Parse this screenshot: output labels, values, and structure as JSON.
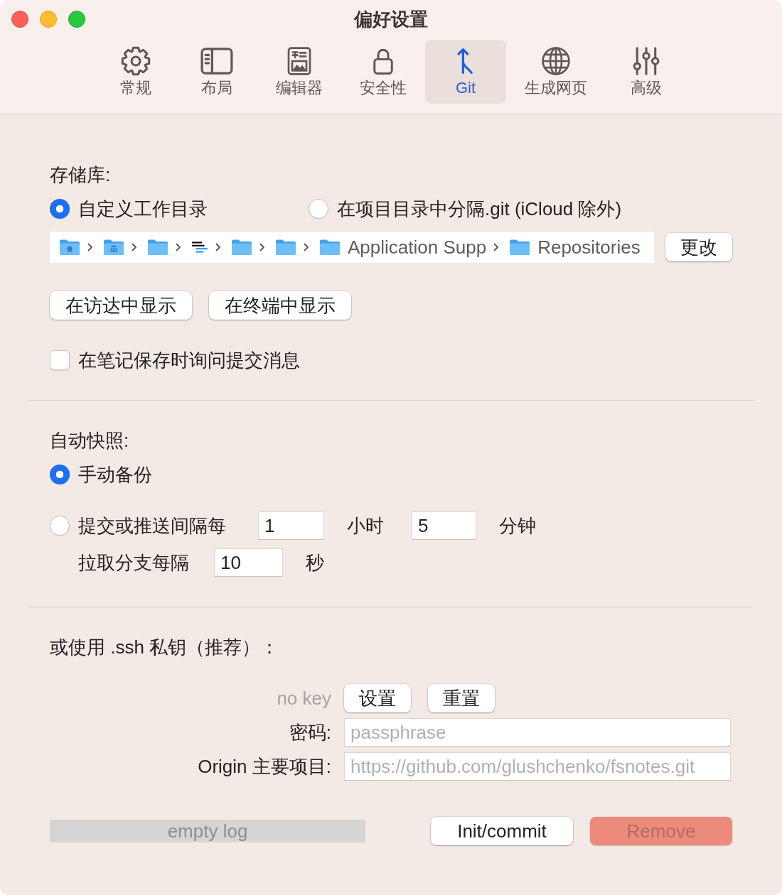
{
  "window": {
    "title": "偏好设置"
  },
  "tabs": [
    {
      "kind": "general",
      "label": "常规",
      "selected": false
    },
    {
      "kind": "layout",
      "label": "布局",
      "selected": false
    },
    {
      "kind": "editor",
      "label": "编辑器",
      "selected": false
    },
    {
      "kind": "security",
      "label": "安全性",
      "selected": false
    },
    {
      "kind": "git",
      "label": "Git",
      "selected": true
    },
    {
      "kind": "web",
      "label": "生成网页",
      "selected": false
    },
    {
      "kind": "advanced",
      "label": "高级",
      "selected": false
    }
  ],
  "repository": {
    "heading": "存储库:",
    "options": [
      {
        "label": "自定义工作目录",
        "selected": true
      },
      {
        "label": "在项目目录中分隔.git (iCloud 除外)",
        "selected": false
      }
    ],
    "path": [
      {
        "kind": "home"
      },
      {
        "kind": "library"
      },
      {
        "kind": "folder"
      },
      {
        "kind": "app"
      },
      {
        "kind": "folder"
      },
      {
        "kind": "folder"
      },
      {
        "kind": "folder",
        "label": "Application Supp"
      },
      {
        "kind": "folder",
        "label": "Repositories"
      }
    ],
    "change_button": "更改",
    "buttons": [
      "在访达中显示",
      "在终端中显示"
    ],
    "ask_commit": {
      "label": "在笔记保存时询问提交消息",
      "checked": false
    }
  },
  "snapshots": {
    "heading": "自动快照:",
    "options": [
      {
        "kind": "plain",
        "label": "手动备份",
        "selected": true
      },
      {
        "kind": "interval",
        "label": "提交或推送间隔每",
        "selected": false,
        "fields": [
          {
            "value": "1",
            "unit": "小时"
          },
          {
            "value": "5",
            "unit": "分钟"
          }
        ]
      }
    ],
    "pull": {
      "label": "拉取分支每隔",
      "value": "10",
      "unit": "秒"
    }
  },
  "ssh": {
    "heading": "或使用 .ssh 私钥（推荐）：",
    "key_status": "no key",
    "key_buttons": [
      "设置",
      "重置"
    ],
    "fields": [
      {
        "label": "密码:",
        "placeholder": "passphrase"
      },
      {
        "label": "Origin 主要项目:",
        "placeholder": "https://github.com/glushchenko/fsnotes.git"
      }
    ]
  },
  "footer": {
    "log": "empty log",
    "buttons": [
      {
        "kind": "default",
        "label": "Init/commit",
        "disabled": false
      },
      {
        "kind": "destructive",
        "label": "Remove",
        "disabled": true
      }
    ]
  }
}
